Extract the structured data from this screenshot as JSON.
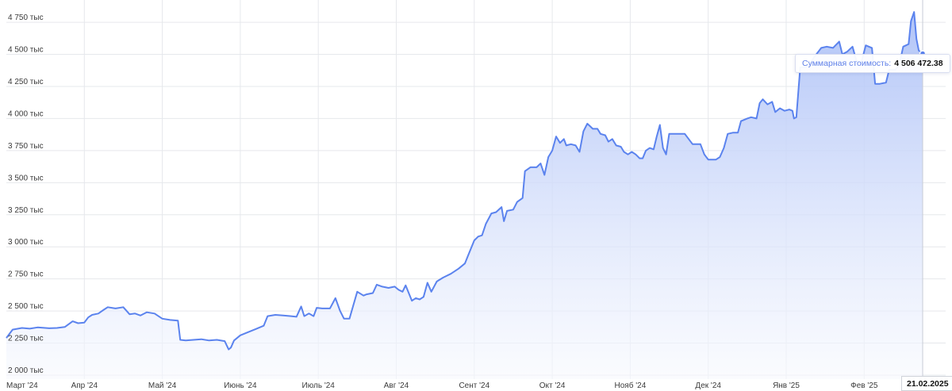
{
  "chart_data": {
    "type": "area",
    "x_labels": [
      "Март '24",
      "Апр '24",
      "Май '24",
      "Июнь '24",
      "Июль '24",
      "Авг '24",
      "Сент '24",
      "Окт '24",
      "Нояб '24",
      "Дек '24",
      "Янв '25",
      "Фев '25"
    ],
    "y_ticks": [
      {
        "value": 2000000,
        "label": "2 000 тыс"
      },
      {
        "value": 2250000,
        "label": "2 250 тыс"
      },
      {
        "value": 2500000,
        "label": "2 500 тыс"
      },
      {
        "value": 2750000,
        "label": "2 750 тыс"
      },
      {
        "value": 3000000,
        "label": "3 000 тыс"
      },
      {
        "value": 3250000,
        "label": "3 250 тыс"
      },
      {
        "value": 3500000,
        "label": "3 500 тыс"
      },
      {
        "value": 3750000,
        "label": "3 750 тыс"
      },
      {
        "value": 4000000,
        "label": "4 000 тыс"
      },
      {
        "value": 4250000,
        "label": "4 250 тыс"
      },
      {
        "value": 4500000,
        "label": "4 500 тыс"
      },
      {
        "value": 4750000,
        "label": "4 750 тыс"
      }
    ],
    "ylim": [
      2000000,
      4800000
    ],
    "xlim": [
      0,
      11.75
    ],
    "grid": true,
    "colors": {
      "line": "#5b83ee",
      "fill_top": "#adc1f7",
      "fill_bottom": "#f7f9fe",
      "grid": "#e6e8ec"
    },
    "series": [
      {
        "points": [
          [
            0.0,
            2290
          ],
          [
            0.08,
            2355
          ],
          [
            0.2,
            2368
          ],
          [
            0.3,
            2362
          ],
          [
            0.4,
            2372
          ],
          [
            0.55,
            2365
          ],
          [
            0.65,
            2368
          ],
          [
            0.75,
            2375
          ],
          [
            0.85,
            2420
          ],
          [
            0.92,
            2405
          ],
          [
            1.0,
            2410
          ],
          [
            1.05,
            2450
          ],
          [
            1.1,
            2470
          ],
          [
            1.18,
            2480
          ],
          [
            1.25,
            2510
          ],
          [
            1.3,
            2530
          ],
          [
            1.4,
            2520
          ],
          [
            1.5,
            2530
          ],
          [
            1.58,
            2475
          ],
          [
            1.65,
            2480
          ],
          [
            1.72,
            2465
          ],
          [
            1.8,
            2490
          ],
          [
            1.9,
            2480
          ],
          [
            2.0,
            2440
          ],
          [
            2.1,
            2430
          ],
          [
            2.2,
            2425
          ],
          [
            2.23,
            2275
          ],
          [
            2.3,
            2270
          ],
          [
            2.4,
            2275
          ],
          [
            2.5,
            2280
          ],
          [
            2.6,
            2270
          ],
          [
            2.7,
            2275
          ],
          [
            2.8,
            2265
          ],
          [
            2.85,
            2200
          ],
          [
            2.88,
            2215
          ],
          [
            2.92,
            2270
          ],
          [
            3.0,
            2310
          ],
          [
            3.1,
            2335
          ],
          [
            3.2,
            2360
          ],
          [
            3.3,
            2385
          ],
          [
            3.35,
            2460
          ],
          [
            3.45,
            2470
          ],
          [
            3.55,
            2465
          ],
          [
            3.65,
            2460
          ],
          [
            3.72,
            2455
          ],
          [
            3.78,
            2535
          ],
          [
            3.82,
            2460
          ],
          [
            3.88,
            2480
          ],
          [
            3.94,
            2460
          ],
          [
            3.98,
            2525
          ],
          [
            4.05,
            2520
          ],
          [
            4.15,
            2520
          ],
          [
            4.22,
            2600
          ],
          [
            4.28,
            2500
          ],
          [
            4.33,
            2440
          ],
          [
            4.4,
            2440
          ],
          [
            4.5,
            2650
          ],
          [
            4.58,
            2620
          ],
          [
            4.62,
            2630
          ],
          [
            4.7,
            2640
          ],
          [
            4.75,
            2705
          ],
          [
            4.82,
            2690
          ],
          [
            4.9,
            2680
          ],
          [
            4.98,
            2690
          ],
          [
            5.03,
            2665
          ],
          [
            5.08,
            2650
          ],
          [
            5.12,
            2700
          ],
          [
            5.2,
            2580
          ],
          [
            5.25,
            2600
          ],
          [
            5.3,
            2590
          ],
          [
            5.35,
            2610
          ],
          [
            5.4,
            2720
          ],
          [
            5.45,
            2650
          ],
          [
            5.52,
            2730
          ],
          [
            5.6,
            2760
          ],
          [
            5.7,
            2790
          ],
          [
            5.8,
            2830
          ],
          [
            5.88,
            2870
          ],
          [
            5.92,
            2930
          ],
          [
            6.0,
            3050
          ],
          [
            6.05,
            3080
          ],
          [
            6.1,
            3090
          ],
          [
            6.15,
            3180
          ],
          [
            6.22,
            3260
          ],
          [
            6.28,
            3270
          ],
          [
            6.35,
            3310
          ],
          [
            6.38,
            3200
          ],
          [
            6.42,
            3280
          ],
          [
            6.5,
            3290
          ],
          [
            6.55,
            3350
          ],
          [
            6.62,
            3380
          ],
          [
            6.65,
            3590
          ],
          [
            6.72,
            3620
          ],
          [
            6.8,
            3620
          ],
          [
            6.85,
            3650
          ],
          [
            6.9,
            3560
          ],
          [
            6.95,
            3700
          ],
          [
            7.0,
            3750
          ],
          [
            7.05,
            3860
          ],
          [
            7.1,
            3810
          ],
          [
            7.15,
            3840
          ],
          [
            7.18,
            3790
          ],
          [
            7.24,
            3800
          ],
          [
            7.3,
            3790
          ],
          [
            7.35,
            3740
          ],
          [
            7.4,
            3900
          ],
          [
            7.45,
            3960
          ],
          [
            7.52,
            3920
          ],
          [
            7.58,
            3920
          ],
          [
            7.62,
            3880
          ],
          [
            7.68,
            3870
          ],
          [
            7.72,
            3820
          ],
          [
            7.77,
            3840
          ],
          [
            7.82,
            3790
          ],
          [
            7.88,
            3780
          ],
          [
            7.92,
            3740
          ],
          [
            7.97,
            3720
          ],
          [
            8.02,
            3740
          ],
          [
            8.07,
            3720
          ],
          [
            8.12,
            3690
          ],
          [
            8.16,
            3690
          ],
          [
            8.2,
            3750
          ],
          [
            8.25,
            3770
          ],
          [
            8.3,
            3760
          ],
          [
            8.34,
            3860
          ],
          [
            8.38,
            3950
          ],
          [
            8.42,
            3770
          ],
          [
            8.46,
            3720
          ],
          [
            8.5,
            3880
          ],
          [
            8.55,
            3880
          ],
          [
            8.62,
            3880
          ],
          [
            8.7,
            3880
          ],
          [
            8.8,
            3800
          ],
          [
            8.9,
            3800
          ],
          [
            8.95,
            3720
          ],
          [
            9.0,
            3680
          ],
          [
            9.1,
            3680
          ],
          [
            9.15,
            3700
          ],
          [
            9.2,
            3770
          ],
          [
            9.25,
            3880
          ],
          [
            9.32,
            3890
          ],
          [
            9.38,
            3890
          ],
          [
            9.42,
            3980
          ],
          [
            9.5,
            4000
          ],
          [
            9.55,
            4010
          ],
          [
            9.62,
            4000
          ],
          [
            9.66,
            4120
          ],
          [
            9.7,
            4150
          ],
          [
            9.76,
            4110
          ],
          [
            9.82,
            4130
          ],
          [
            9.86,
            4050
          ],
          [
            9.92,
            4080
          ],
          [
            9.98,
            4060
          ],
          [
            10.04,
            4070
          ],
          [
            10.08,
            4060
          ],
          [
            10.1,
            4000
          ],
          [
            10.13,
            4010
          ],
          [
            10.18,
            4400
          ],
          [
            10.25,
            4400
          ],
          [
            10.3,
            4420
          ],
          [
            10.36,
            4480
          ],
          [
            10.45,
            4550
          ],
          [
            10.52,
            4560
          ],
          [
            10.6,
            4550
          ],
          [
            10.68,
            4600
          ],
          [
            10.72,
            4500
          ],
          [
            10.78,
            4520
          ],
          [
            10.85,
            4560
          ],
          [
            10.9,
            4450
          ],
          [
            10.96,
            4430
          ],
          [
            11.02,
            4570
          ],
          [
            11.1,
            4550
          ],
          [
            11.14,
            4270
          ],
          [
            11.2,
            4270
          ],
          [
            11.28,
            4280
          ],
          [
            11.32,
            4380
          ],
          [
            11.4,
            4380
          ],
          [
            11.45,
            4420
          ],
          [
            11.5,
            4560
          ],
          [
            11.57,
            4580
          ],
          [
            11.6,
            4760
          ],
          [
            11.64,
            4830
          ],
          [
            11.67,
            4620
          ],
          [
            11.7,
            4530
          ],
          [
            11.75,
            4506.47
          ]
        ]
      }
    ],
    "tooltip": {
      "label": "Суммарная стоимость:",
      "value": "4 506 472.38"
    },
    "date_label": "21.02.2025"
  }
}
